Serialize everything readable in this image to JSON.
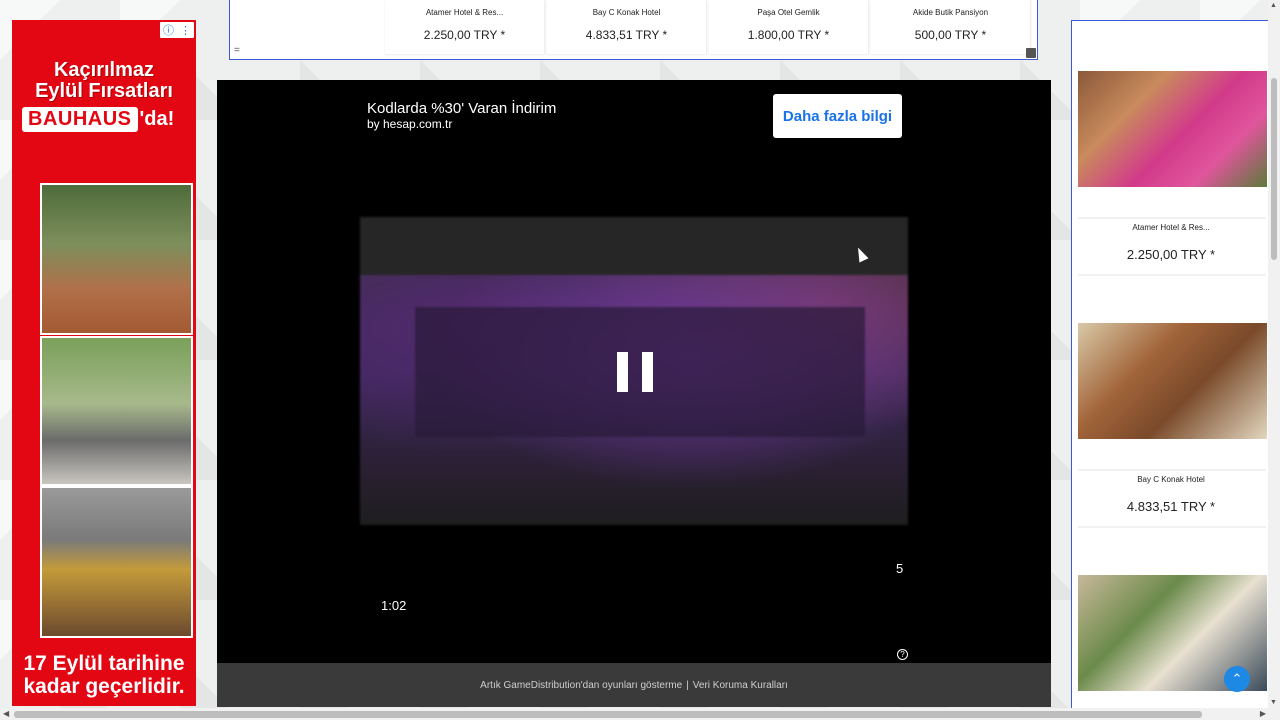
{
  "left_ad": {
    "headline_line1": "Kaçırılmaz",
    "headline_line2": "Eylül Fırsatları",
    "brand": "BAUHAUS",
    "brand_suffix": "'da!",
    "tagline_line1": "17 Eylül tarihine",
    "tagline_line2": "kadar geçerlidir.",
    "info_icon": "info-icon",
    "menu_icon": "kebab-menu-icon"
  },
  "top_widget": {
    "hotels": [
      {
        "name": "Atamer Hotel & Res...",
        "price": "2.250,00 TRY *"
      },
      {
        "name": "Bay C Konak Hotel",
        "price": "4.833,51 TRY *"
      },
      {
        "name": "Paşa Otel Gemlik",
        "price": "1.800,00 TRY *"
      },
      {
        "name": "Akide Butik Pansiyon",
        "price": "500,00 TRY *"
      }
    ],
    "menu_glyph": "="
  },
  "player": {
    "ad_title": "Kodlarda %30' Varan İndirim",
    "ad_by": "by hesap.com.tr",
    "cta_label": "Daha fazla bilgi",
    "countdown": "5",
    "time": "1:02",
    "help_glyph": "?",
    "footer_text": "Artık GameDistribution'dan oyunları gösterme",
    "footer_sep": "|",
    "footer_link": "Veri Koruma Kuralları"
  },
  "right_widget": {
    "hotels": [
      {
        "name": "Atamer Hotel & Res...",
        "price": "2.250,00 TRY *"
      },
      {
        "name": "Bay C Konak Hotel",
        "price": "4.833,51 TRY *"
      }
    ]
  },
  "scroll_top_glyph": "⌃"
}
